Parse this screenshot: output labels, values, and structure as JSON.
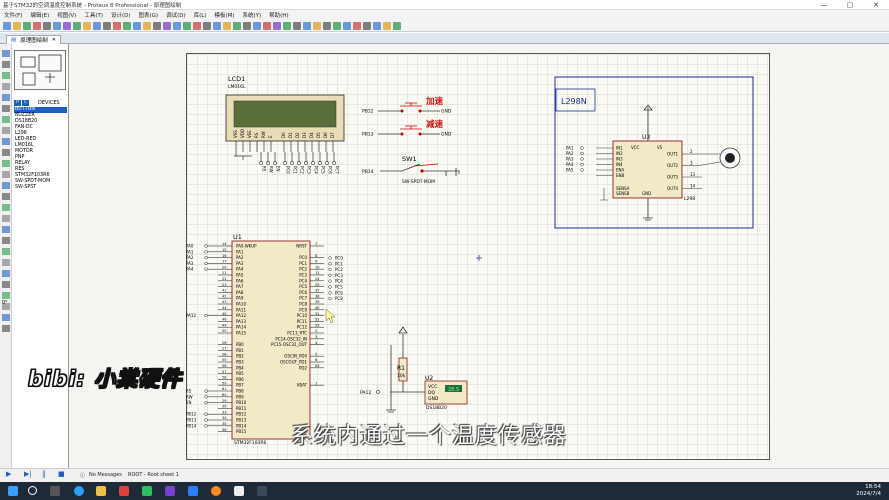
{
  "window": {
    "title": "基于STM32的空调温度控制系统 - Proteus 8 Professional - 原理图绘制",
    "controls": [
      "—",
      "▢",
      "✕"
    ]
  },
  "menu": [
    "文件(F)",
    "编辑(E)",
    "视图(V)",
    "工具(T)",
    "设计(D)",
    "图表(G)",
    "调试(D)",
    "库(L)",
    "模板(M)",
    "系统(Y)",
    "帮助(H)"
  ],
  "tab": {
    "label": "原理图绘制",
    "close": "✕"
  },
  "left_panel": {
    "buttons": [
      "P",
      "L"
    ],
    "devices_label": "DEVICES",
    "devices": [
      "BUTTON",
      "BUZZER",
      "DS18B20",
      "FAN-DC",
      "L298",
      "LED-RED",
      "LM016L",
      "MOTOR",
      "PNP",
      "RELAY",
      "RES",
      "STM32F103R6",
      "SW-SPDT-MOM",
      "SW-SPST"
    ],
    "selected_device": "BUTTON",
    "zoom_label": "0°"
  },
  "schematic": {
    "lcd": {
      "ref": "LCD1",
      "part": "LM016L",
      "pins": [
        "VSS",
        "VDD",
        "VEE",
        "RS",
        "RW",
        "E",
        "D0",
        "D1",
        "D2",
        "D3",
        "D4",
        "D5",
        "D6",
        "D7"
      ],
      "nets": [
        "RS",
        "RW",
        "EN",
        "PC0",
        "PC1",
        "PC2",
        "PC3",
        "PC4",
        "PC5",
        "PC6",
        "PC7"
      ]
    },
    "buttons": [
      {
        "net": "PB12",
        "label": "加速",
        "gnd": "GND"
      },
      {
        "net": "PB13",
        "label": "减速",
        "gnd": "GND"
      }
    ],
    "switch": {
      "ref": "SW1",
      "part": "SW-SPDT-MOM",
      "net": "PB14"
    },
    "driver_box_label": "L298N",
    "l298": {
      "ref": "U3",
      "part": "L298",
      "inputs": [
        "IN1",
        "IN2",
        "IN3",
        "IN4",
        "ENA",
        "ENB"
      ],
      "input_nets": [
        "PA1",
        "PA2",
        "PA3",
        "PA4",
        "PA5"
      ],
      "power": [
        "VCC",
        "VS"
      ],
      "outputs": [
        "OUT1",
        "OUT2",
        "OUT3",
        "OUT4"
      ],
      "output_pins": [
        "2",
        "3",
        "13",
        "14"
      ],
      "sense": [
        "SENSA",
        "SENSB",
        "GND"
      ]
    },
    "mcu": {
      "ref": "U1",
      "part": "STM32F103R6",
      "left_pins": [
        "PA0-WKUP",
        "PA1",
        "PA2",
        "PA3",
        "PA4",
        "PA5",
        "PA6",
        "PA7",
        "PA8",
        "PA9",
        "PA10",
        "PA11",
        "PA12",
        "PA13",
        "PA14",
        "PA15",
        "",
        "PB0",
        "PB1",
        "PB2",
        "PB3",
        "PB4",
        "PB5",
        "PB6",
        "PB7",
        "PB8",
        "PB9",
        "PB10",
        "PB11",
        "PB12",
        "PB13",
        "PB14",
        "PB15"
      ],
      "left_nums": [
        "14",
        "15",
        "16",
        "17",
        "20",
        "21",
        "22",
        "23",
        "41",
        "42",
        "43",
        "44",
        "45",
        "46",
        "49",
        "50",
        "",
        "26",
        "27",
        "28",
        "55",
        "56",
        "57",
        "58",
        "59",
        "61",
        "62",
        "29",
        "30",
        "33",
        "34",
        "35",
        "36"
      ],
      "left_nets": [
        "PA0",
        "PA1",
        "PA2",
        "PA3",
        "PA4",
        "",
        "",
        "",
        "",
        "",
        "",
        "",
        "PA12",
        "",
        "",
        "",
        "",
        "",
        "",
        "",
        "",
        "",
        "",
        "",
        "",
        "RS",
        "RW",
        "EN",
        "",
        "PB12",
        "PB13",
        "PB14",
        ""
      ],
      "right_pins": [
        "NRST",
        "",
        "PC0",
        "PC1",
        "PC2",
        "PC3",
        "PC4",
        "PC5",
        "PC6",
        "PC7",
        "PC8",
        "PC9",
        "PC10",
        "PC11",
        "PC12",
        "PC13_RTC",
        "PC14-OSC32_IN",
        "PC15-OSC32_OUT",
        "",
        "OSCIN_PD0",
        "OSCOUT_PD1",
        "PD2",
        "",
        "",
        "VBAT"
      ],
      "right_nums": [
        "7",
        "",
        "8",
        "9",
        "10",
        "11",
        "24",
        "25",
        "37",
        "38",
        "39",
        "40",
        "51",
        "52",
        "53",
        "2",
        "3",
        "4",
        "",
        "5",
        "6",
        "54",
        "",
        "",
        "1"
      ],
      "right_nets": [
        "PC0",
        "PC1",
        "PC2",
        "PC3",
        "PC4",
        "PC5",
        "PC6",
        "PC8"
      ]
    },
    "resistor": {
      "ref": "R1",
      "value": "10k"
    },
    "sensor": {
      "ref": "U2",
      "part": "DS18B20",
      "pins": [
        "VCC",
        "DQ",
        "GND"
      ],
      "display": "28.5",
      "net": "PA12"
    }
  },
  "overlay": {
    "watermark": "bibi: 小棠硬件",
    "subtitle": "系统内通过一个温度传感器"
  },
  "status": {
    "messages": "No Messages",
    "sheet": "ROOT - Root sheet 1"
  },
  "taskbar": {
    "time": "18:54",
    "date": "2024/7/4"
  }
}
